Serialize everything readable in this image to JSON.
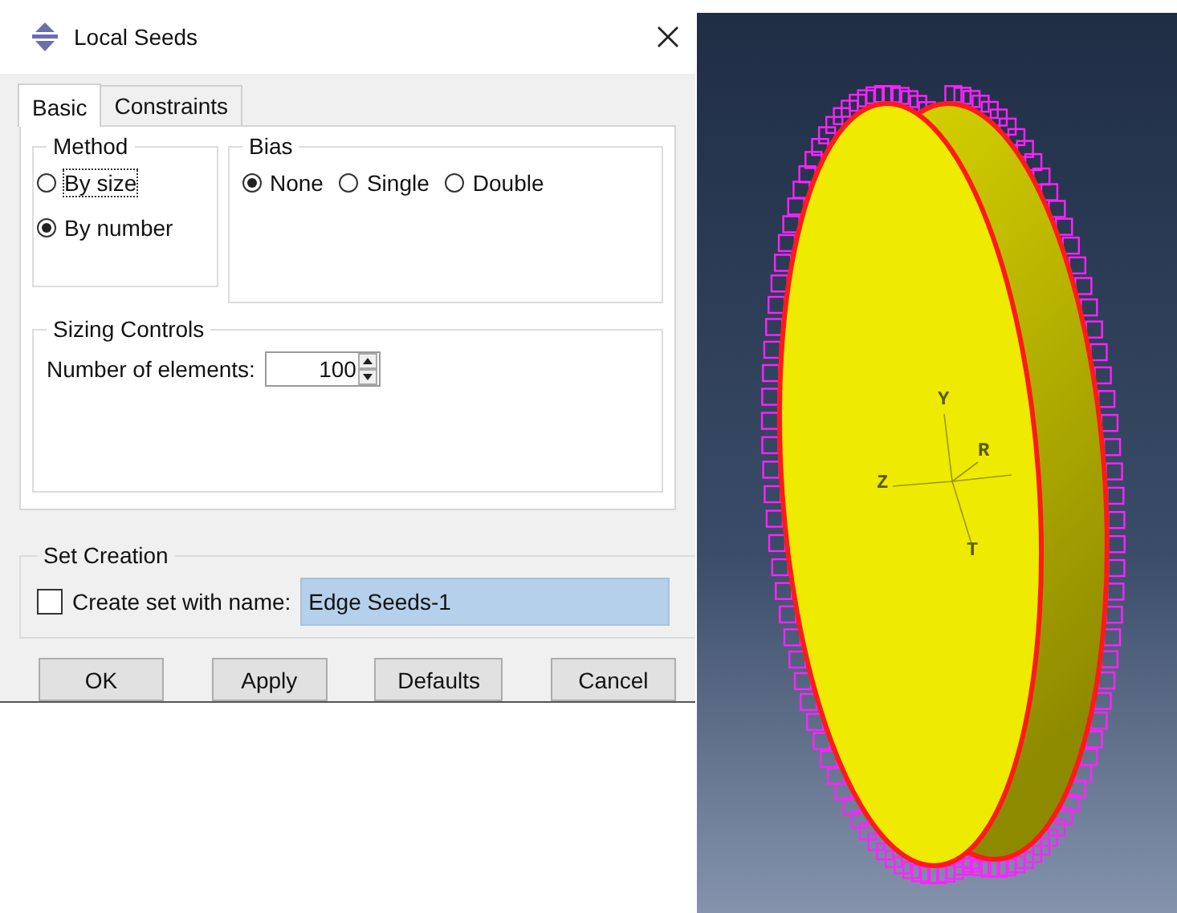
{
  "dialog": {
    "title": "Local Seeds"
  },
  "tabs": [
    {
      "label": "Basic",
      "selected": true
    },
    {
      "label": "Constraints",
      "selected": false
    }
  ],
  "method": {
    "title": "Method",
    "options": [
      {
        "label": "By size",
        "selected": false,
        "focused": true
      },
      {
        "label": "By number",
        "selected": true,
        "focused": false
      }
    ]
  },
  "bias": {
    "title": "Bias",
    "options": [
      {
        "label": "None",
        "selected": true
      },
      {
        "label": "Single",
        "selected": false
      },
      {
        "label": "Double",
        "selected": false
      }
    ]
  },
  "sizing_controls": {
    "title": "Sizing Controls",
    "label": "Number of elements:",
    "value": "100"
  },
  "set_creation": {
    "title": "Set Creation",
    "checkbox": {
      "label": "Create set with name:",
      "checked": false
    },
    "name_value": "Edge Seeds-1"
  },
  "buttons": [
    "OK",
    "Apply",
    "Defaults",
    "Cancel"
  ],
  "viewport": {
    "axis_labels": [
      "Y",
      "R",
      "Z",
      "T"
    ]
  }
}
